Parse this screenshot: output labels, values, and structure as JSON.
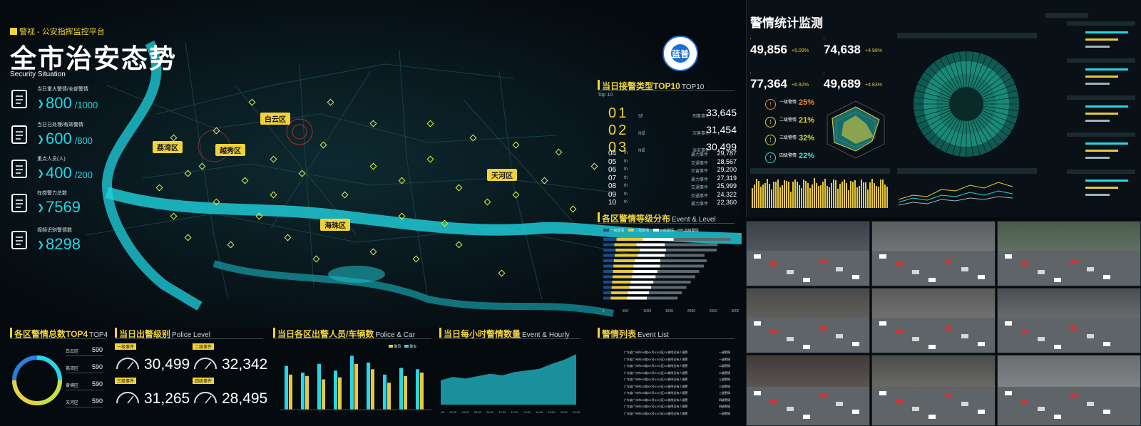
{
  "header": {
    "brand": "警视 - 公安指挥监控平台",
    "title": "全市治安态势",
    "subtitle": "Security Situation",
    "logo_text": "蓝普"
  },
  "stats": [
    {
      "icon": "clipboard-icon",
      "label": "当日重大警情/全部警情",
      "value": "800",
      "total": "/1000"
    },
    {
      "icon": "checklist-icon",
      "label": "当日已处理/有效警情",
      "value": "600",
      "total": "/800"
    },
    {
      "icon": "person-warning-icon",
      "label": "重点人员(人)",
      "value": "400",
      "total": "/200"
    },
    {
      "icon": "police-badge-icon",
      "label": "在岗警力总数",
      "value": "7569",
      "total": ""
    },
    {
      "icon": "camera-icon",
      "label": "视频识别警情数",
      "value": "8298",
      "total": ""
    }
  ],
  "map": {
    "districts": [
      "白云区",
      "荔湾区",
      "越秀区",
      "天河区",
      "海珠区"
    ]
  },
  "top10": {
    "title": "当日接警类型TOP10",
    "title_en": "TOP10",
    "sub": "Top 10",
    "top3": [
      {
        "rank": "01",
        "suffix": "st",
        "category": "刑事事件",
        "value": "33,645"
      },
      {
        "rank": "02",
        "suffix": "nd",
        "category": "灾害事件",
        "value": "31,454"
      },
      {
        "rank": "03",
        "suffix": "nd",
        "category": "治安事件",
        "value": "30,499"
      }
    ],
    "rest": [
      {
        "rank": "04",
        "suffix": "th",
        "category": "暴力事件",
        "value": "29,787"
      },
      {
        "rank": "05",
        "suffix": "th",
        "category": "交通事件",
        "value": "28,567"
      },
      {
        "rank": "06",
        "suffix": "th",
        "category": "灾害事件",
        "value": "29,200"
      },
      {
        "rank": "07",
        "suffix": "th",
        "category": "暴力事件",
        "value": "27,319"
      },
      {
        "rank": "08",
        "suffix": "th",
        "category": "交通事件",
        "value": "25,999"
      },
      {
        "rank": "09",
        "suffix": "th",
        "category": "交通事件",
        "value": "24,322"
      },
      {
        "rank": "10",
        "suffix": "th",
        "category": "暴力事件",
        "value": "22,360"
      }
    ]
  },
  "district_level": {
    "title": "各区警情等级分布",
    "title_en": "Event & Level",
    "legend": [
      "一级警情",
      "二级警情",
      "三级警情",
      "四级警情"
    ],
    "axis": [
      "0",
      "500",
      "1000",
      "1500",
      "2000",
      "2500",
      "3000"
    ]
  },
  "top4": {
    "title": "各区警情总数TOP4",
    "title_en": "TOP4",
    "rows": [
      {
        "name": "白云区",
        "value": "590"
      },
      {
        "name": "荔湾区",
        "value": "590"
      },
      {
        "name": "黄埔区",
        "value": "590"
      },
      {
        "name": "天河区",
        "value": "590"
      }
    ]
  },
  "police_level": {
    "title": "当日出警级别",
    "title_en": "Police Level",
    "items": [
      {
        "label": "一级事件",
        "value": "30,499"
      },
      {
        "label": "二级事件",
        "value": "32,342"
      },
      {
        "label": "三级事件",
        "value": "31,265"
      },
      {
        "label": "四级事件",
        "value": "28,495"
      }
    ]
  },
  "police_car": {
    "title": "当日各区出警人员/车辆数",
    "title_en": "Police & Car",
    "legend": [
      "警员",
      "警车"
    ]
  },
  "hourly": {
    "title": "当日每小时警情数量",
    "title_en": "Event & Hourly"
  },
  "event_list": {
    "title": "警情列表",
    "title_en": "Event List",
    "rows": [
      {
        "text": "广东省广州市XX路XX号XX小区XX栋附近有人报警",
        "level": "一级警情"
      },
      {
        "text": "广东省广州市XX路XX号XX小区XX栋附近有人报警",
        "level": "一级警情"
      },
      {
        "text": "广东省广州市XX路XX号XX小区XX栋附近有人报警",
        "level": "二级警情"
      },
      {
        "text": "广东省广州市XX路XX号XX小区XX栋附近有人报警",
        "level": "二级警情"
      },
      {
        "text": "广东省广州市XX路XX号XX小区XX栋附近有人报警",
        "level": "三级警情"
      },
      {
        "text": "广东省广州市XX路XX号XX小区XX栋附近有人报警",
        "level": "三级警情"
      },
      {
        "text": "广东省广州市XX路XX号XX小区XX栋附近有人报警",
        "level": "三级警情"
      },
      {
        "text": "广东省广州市XX路XX号XX小区XX栋附近有人报警",
        "level": "四级警情"
      },
      {
        "text": "广东省广州市XX路XX号XX小区XX栋附近有人报警",
        "level": "四级警情"
      },
      {
        "text": "广东省广州市XX路XX号XX小区XX栋附近有人报警",
        "level": "一级警情"
      }
    ]
  },
  "right_panel": {
    "title": "警情统计监测",
    "kpis": [
      {
        "value": "49,856",
        "pct": "+5.09%"
      },
      {
        "value": "74,638",
        "pct": "+4.98%"
      },
      {
        "value": "77,364",
        "pct": "+6.92%"
      },
      {
        "value": "49,689",
        "pct": "+4.83%"
      }
    ],
    "levels": [
      {
        "name": "一级警情",
        "pct": "25%",
        "color": "#f28a2a"
      },
      {
        "name": "二级警情",
        "pct": "21%",
        "color": "#e7d23a"
      },
      {
        "name": "三级警情",
        "pct": "32%",
        "color": "#c7e23a"
      },
      {
        "name": "四级警情",
        "pct": "22%",
        "color": "#3ae0d0"
      }
    ]
  },
  "chart_data": [
    {
      "type": "bar",
      "title": "各区警情等级分布",
      "stacked": true,
      "orientation": "horizontal",
      "xlim": [
        0,
        3000
      ],
      "series": [
        {
          "name": "一级警情",
          "values": [
            300,
            250,
            280,
            260,
            240,
            230,
            220,
            210,
            200,
            190,
            180,
            170
          ]
        },
        {
          "name": "二级警情",
          "values": [
            600,
            500,
            550,
            520,
            480,
            460,
            450,
            440,
            420,
            400,
            380,
            360
          ]
        },
        {
          "name": "三级警情",
          "values": [
            700,
            650,
            600,
            620,
            580,
            600,
            560,
            540,
            520,
            500,
            480,
            460
          ]
        },
        {
          "name": "四级警情",
          "values": [
            1300,
            1200,
            1150,
            900,
            1050,
            1000,
            950,
            900,
            850,
            800,
            750,
            700
          ]
        }
      ]
    },
    {
      "type": "pie",
      "title": "各区警情总数TOP4",
      "categories": [
        "白云区",
        "荔湾区",
        "黄埔区",
        "天河区"
      ],
      "values": [
        590,
        590,
        590,
        590
      ]
    },
    {
      "type": "bar",
      "title": "当日各区出警人员/车辆数",
      "series": [
        {
          "name": "警员",
          "values": [
            65,
            55,
            68,
            58,
            80,
            70,
            52,
            62,
            60
          ]
        },
        {
          "name": "警车",
          "values": [
            52,
            50,
            45,
            48,
            68,
            60,
            40,
            50,
            55
          ]
        }
      ]
    },
    {
      "type": "area",
      "title": "当日每小时警情数量",
      "x": [
        "00:00",
        "02:00",
        "04:00",
        "06:00",
        "08:00",
        "10:00",
        "12:00",
        "14:00",
        "16:00",
        "18:00",
        "20:00",
        "22:00"
      ],
      "values": [
        30,
        34,
        32,
        35,
        38,
        36,
        40,
        42,
        44,
        50,
        55,
        62
      ]
    }
  ]
}
